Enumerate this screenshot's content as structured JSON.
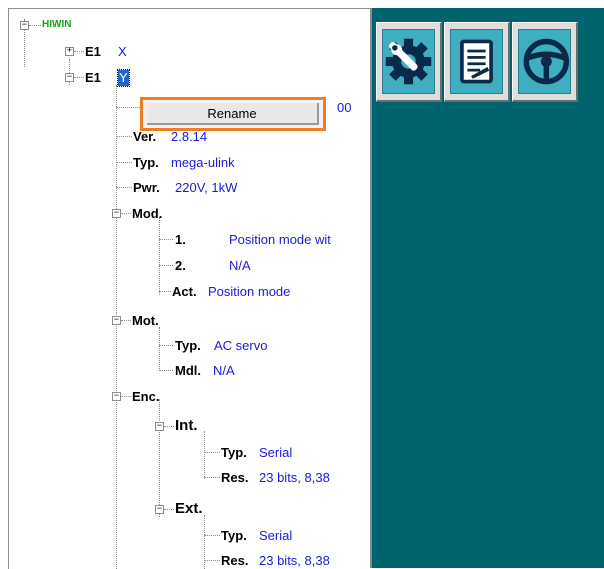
{
  "tree": {
    "root": "HIWIN",
    "axis_x": {
      "label": "E1",
      "value": "X"
    },
    "axis_y": {
      "label": "E1",
      "value": "Y"
    },
    "hidden_value_fragment": "00",
    "ver": {
      "label": "Ver.",
      "value": "2.8.14"
    },
    "typ": {
      "label": "Typ.",
      "value": "mega-ulink"
    },
    "pwr": {
      "label": "Pwr.",
      "value": "220V, 1kW"
    },
    "mod": {
      "label": "Mod.",
      "item1": {
        "label": "1.",
        "value": "Position mode wit"
      },
      "item2": {
        "label": "2.",
        "value": "N/A"
      },
      "act": {
        "label": "Act.",
        "value": "Position mode"
      }
    },
    "mot": {
      "label": "Mot.",
      "typ": {
        "label": "Typ.",
        "value": "AC servo"
      },
      "mdl": {
        "label": "Mdl.",
        "value": "N/A"
      }
    },
    "enc": {
      "label": "Enc.",
      "int": {
        "label": "Int.",
        "typ": {
          "label": "Typ.",
          "value": "Serial"
        },
        "res": {
          "label": "Res.",
          "value": "23 bits, 8,38"
        }
      },
      "ext": {
        "label": "Ext.",
        "typ": {
          "label": "Typ.",
          "value": "Serial"
        },
        "res": {
          "label": "Res.",
          "value": "23 bits, 8,38"
        }
      }
    }
  },
  "context_menu": {
    "rename": "Rename"
  },
  "toolbar": {
    "icons": [
      "wrench-gear-icon",
      "document-icon",
      "steering-wheel-icon"
    ]
  },
  "colors": {
    "panel": "#00636e",
    "button_face": "#3faec1",
    "highlight": "#f07d22",
    "value_text": "#1a1add",
    "root_text": "#18a018"
  }
}
